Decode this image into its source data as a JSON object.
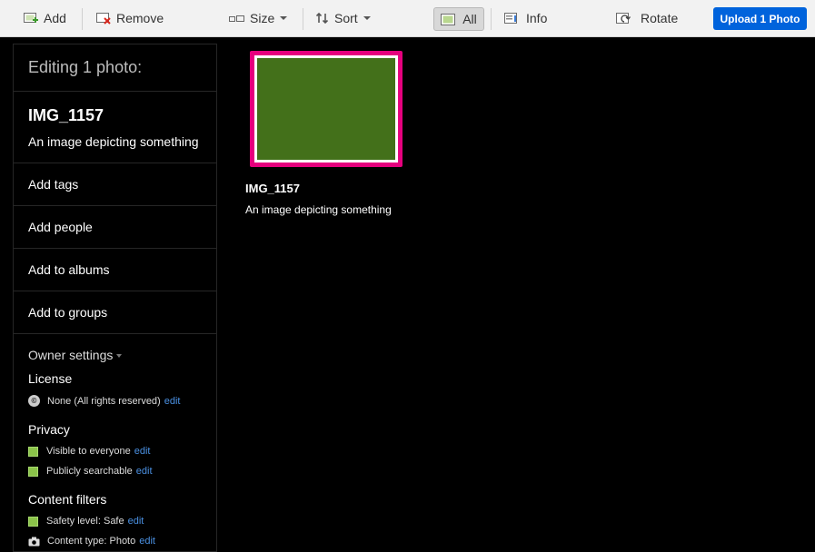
{
  "toolbar": {
    "add": "Add",
    "remove": "Remove",
    "size": "Size",
    "sort": "Sort",
    "all": "All",
    "info": "Info",
    "rotate": "Rotate",
    "upload": "Upload 1 Photo"
  },
  "panel": {
    "heading": "Editing 1 photo:",
    "photo_title": "IMG_1157",
    "photo_desc": "An image depicting something",
    "actions": [
      "Add tags",
      "Add people",
      "Add to albums",
      "Add to groups"
    ],
    "owner_settings": "Owner settings",
    "license": {
      "label": "License",
      "value": "None (All rights reserved)",
      "edit": "edit"
    },
    "privacy": {
      "label": "Privacy",
      "items": [
        {
          "text": "Visible to everyone",
          "edit": "edit"
        },
        {
          "text": "Publicly searchable",
          "edit": "edit"
        }
      ]
    },
    "content_filters": {
      "label": "Content filters",
      "items": [
        {
          "text": "Safety level: Safe",
          "edit": "edit"
        },
        {
          "text": "Content type: Photo",
          "edit": "edit"
        }
      ]
    }
  },
  "photo": {
    "title": "IMG_1157",
    "desc": "An image depicting something",
    "color": "#43701a",
    "selected_border": "#e6007e"
  }
}
